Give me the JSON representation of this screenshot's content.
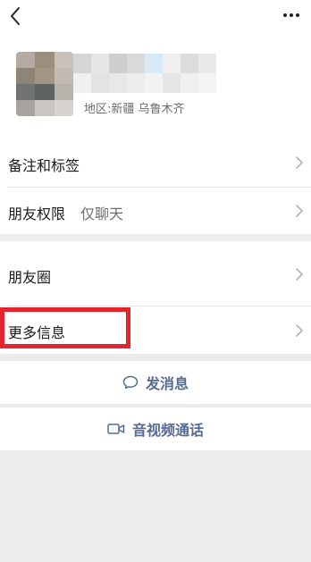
{
  "profile": {
    "region": "地区:新疆 乌鲁木齐",
    "avatar_icon": "blurred-avatar",
    "avatar_colors": [
      "#b6aba2",
      "#9c8d7f",
      "#c8c1ba",
      "#8f8478",
      "#a39584",
      "#c2bbb4",
      "#6f7471",
      "#5c6360",
      "#b7b2ac",
      "#a8a39d",
      "#c9c5c1",
      "#d7d3cf"
    ],
    "name_colors": [
      "#d5d5d5",
      "#e6e6e6",
      "#cfcfcf",
      "#d9d9d9",
      "#d7eaf5",
      "#efefef",
      "#dcdcdc",
      "#e9e9e9",
      "#f0f0f0",
      "#e3e3e3",
      "#e8e8e8",
      "#ececec",
      "#f2f2f2",
      "#e5e5e5",
      "#efefef",
      "#f4f4f4"
    ]
  },
  "rows": {
    "remarks": "备注和标签",
    "permissions_label": "朋友权限",
    "permissions_value": "仅聊天",
    "moments": "朋友圈",
    "more_info": "更多信息"
  },
  "actions": {
    "message": "发消息",
    "call": "音视频通话"
  },
  "icons": {
    "back": "back-chevron-icon",
    "more": "more-dots-icon",
    "chev": "chevron-right-icon",
    "message": "chat-bubble-icon",
    "call": "video-camera-icon"
  },
  "colors": {
    "accent": "#576b95",
    "highlight": "#e5252d"
  }
}
